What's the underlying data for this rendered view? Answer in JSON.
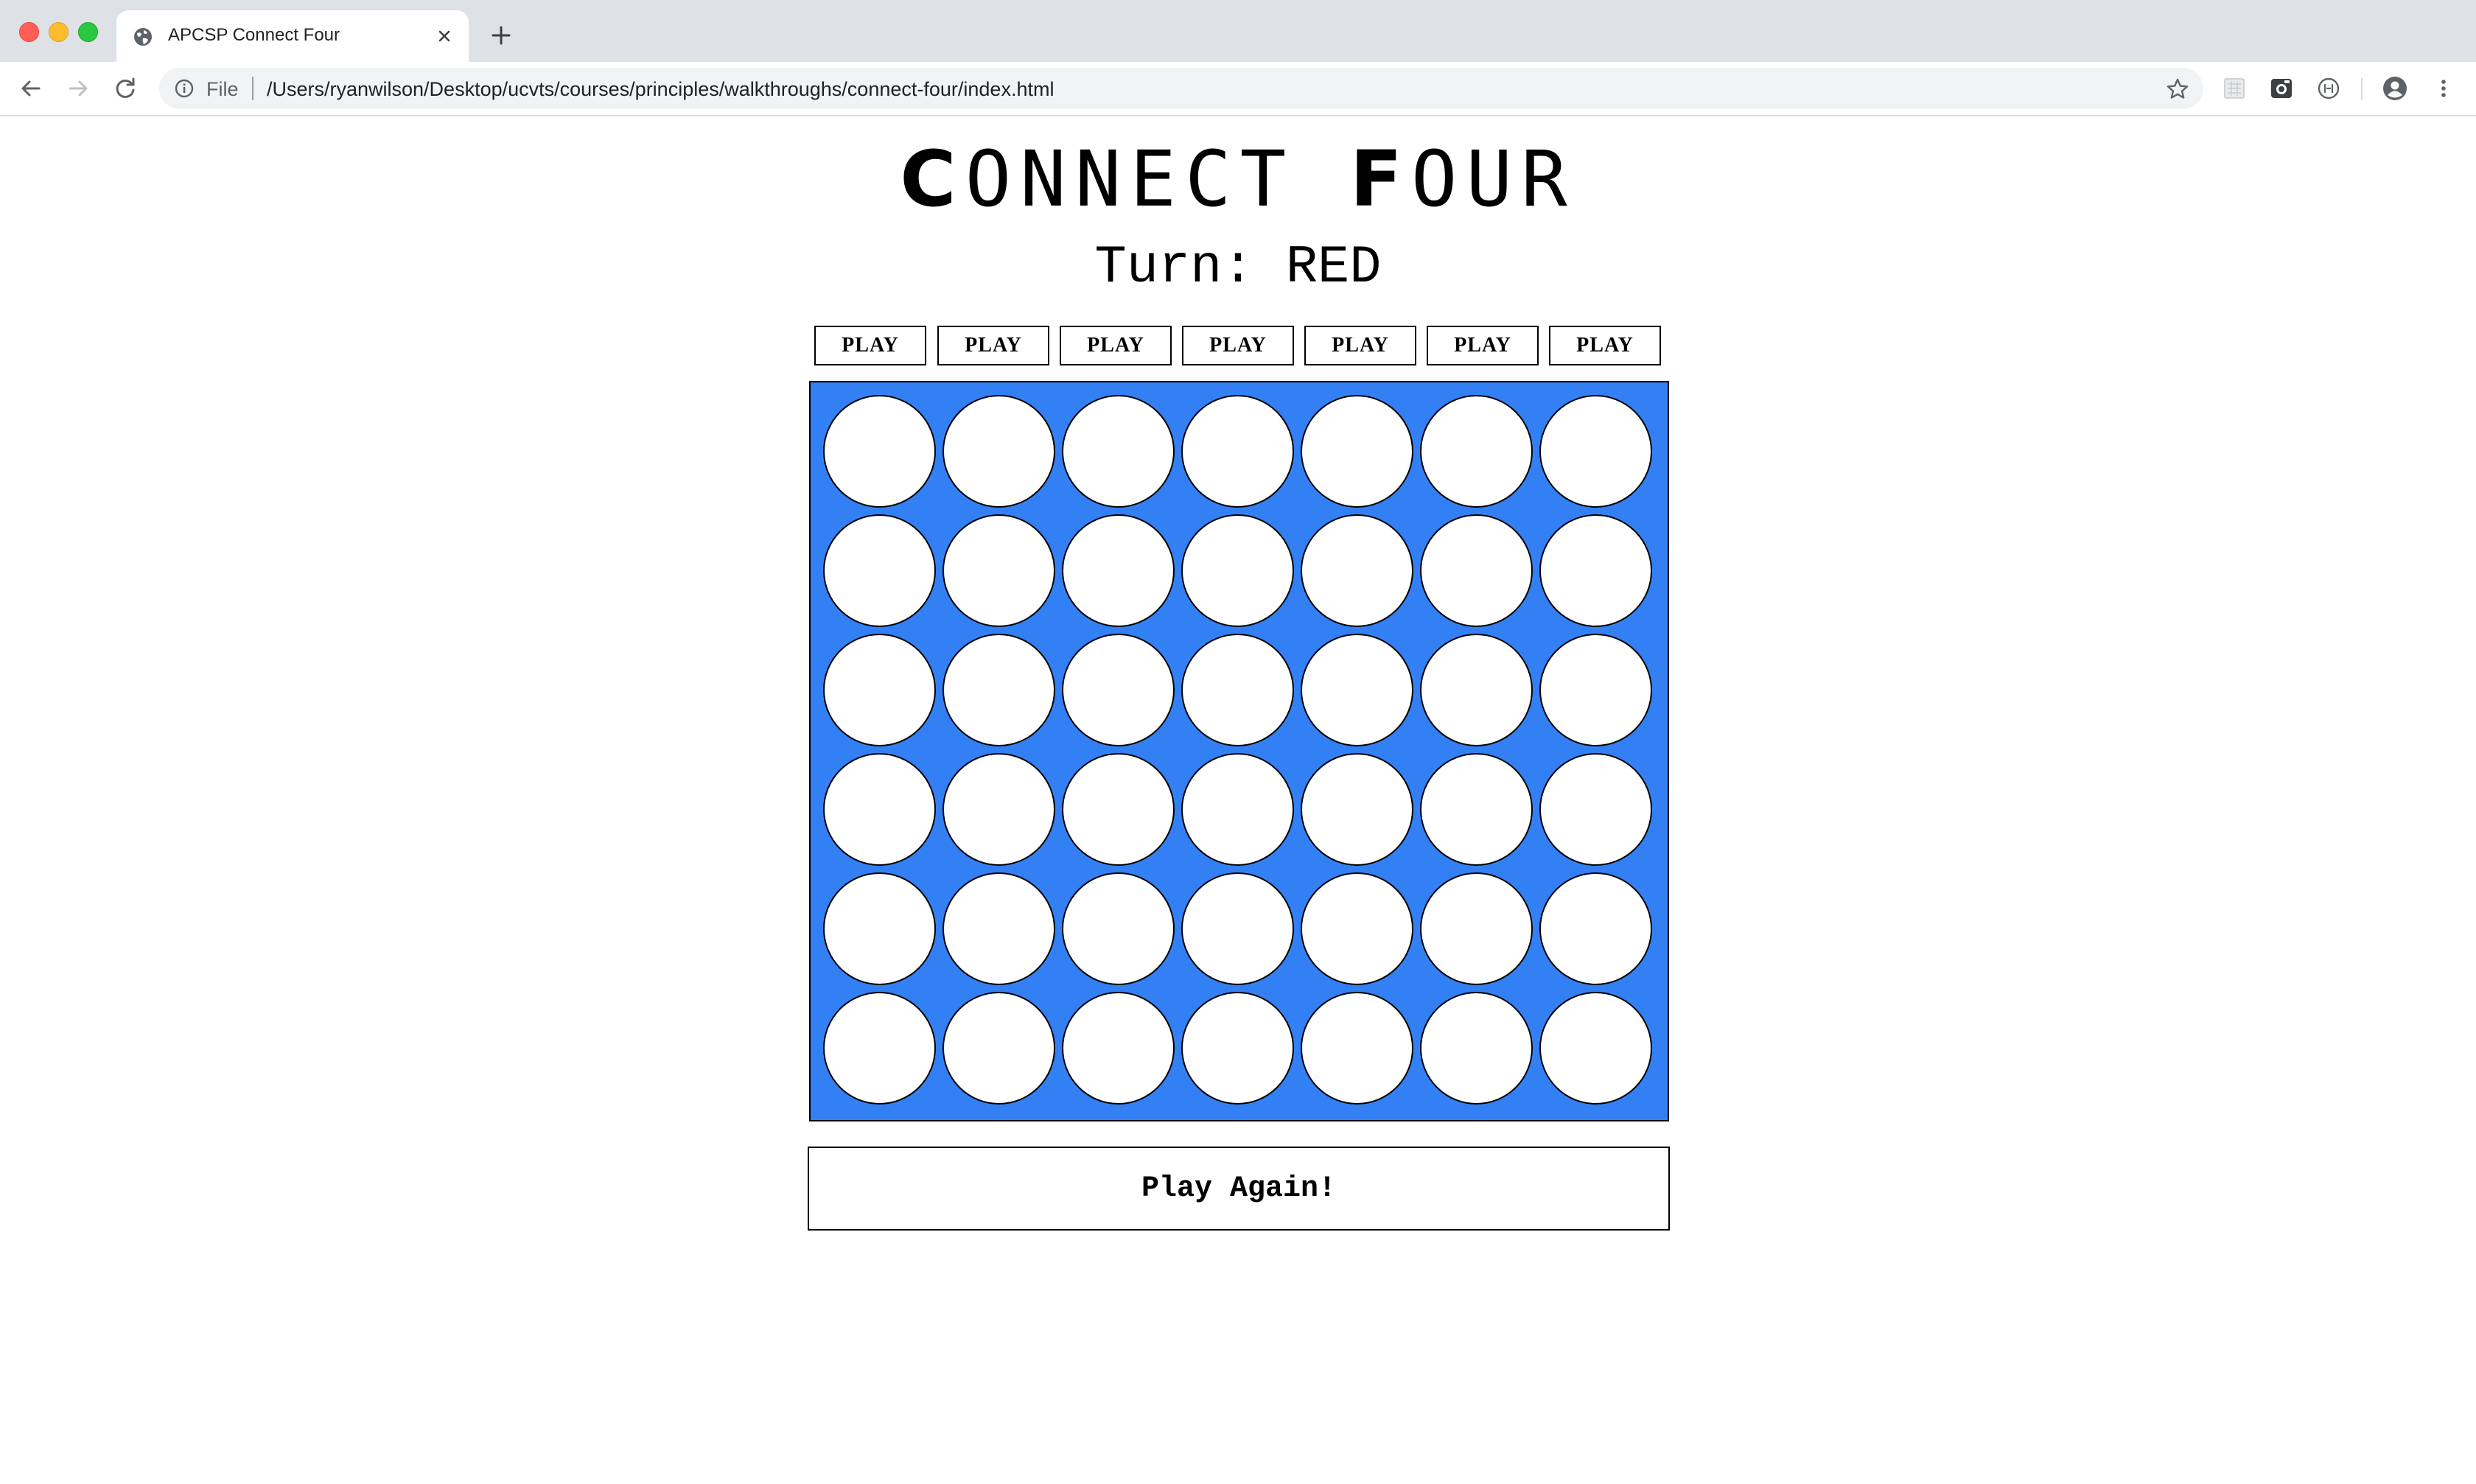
{
  "browser": {
    "tab": {
      "title": "APCSP Connect Four",
      "favicon": "globe-icon"
    },
    "omnibox": {
      "scheme_label": "File",
      "url": "/Users/ryanwilson/Desktop/ucvts/courses/principles/walkthroughs/connect-four/index.html"
    },
    "toolbar_icons": [
      "back-arrow-icon",
      "forward-arrow-icon",
      "reload-icon",
      "info-icon",
      "star-icon",
      "extension-icons",
      "profile-icon",
      "menu-icon"
    ]
  },
  "page": {
    "title_first_letter": "C",
    "title_rest_1": "ONNECT ",
    "title_second_letter": "F",
    "title_rest_2": "OUR",
    "turn_label": "Turn:",
    "turn_value": "RED",
    "play_buttons": [
      "PLAY",
      "PLAY",
      "PLAY",
      "PLAY",
      "PLAY",
      "PLAY",
      "PLAY"
    ],
    "play_again_label": "Play Again!"
  },
  "board": {
    "rows": 6,
    "columns": 7,
    "cell_state": "empty",
    "colors": {
      "board": "#3380f5",
      "empty_cell": "#ffffff",
      "outline": "#000000"
    }
  }
}
